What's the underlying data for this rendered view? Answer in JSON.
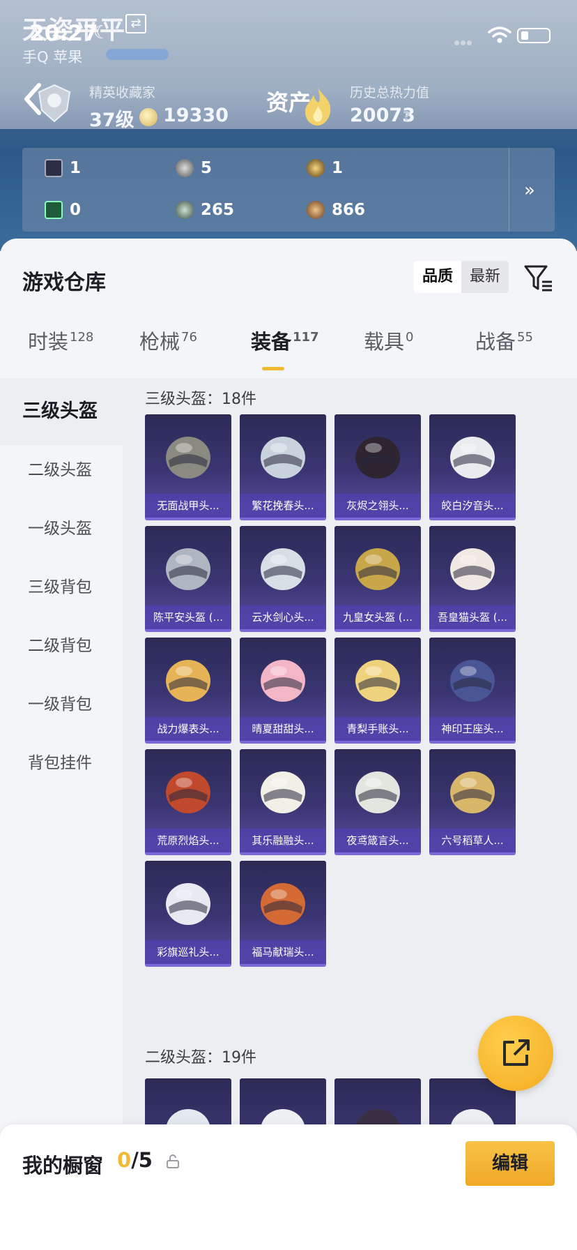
{
  "status": {
    "time": "20:27"
  },
  "profile": {
    "nickname": "天姿平平",
    "platform": "手Q 苹果",
    "rank_title": "精英收藏家",
    "level": "37级",
    "coins": "19330",
    "assets_label": "资产",
    "heat_title": "历史总热力值",
    "heat_value": "20073",
    "help": "?"
  },
  "stats": [
    {
      "icon": "card-icon",
      "value": "1"
    },
    {
      "icon": "silver-coin-icon",
      "value": "5"
    },
    {
      "icon": "gold-token-icon",
      "value": "1"
    },
    {
      "icon": "green-card-icon",
      "value": "0"
    },
    {
      "icon": "green-coin-icon",
      "value": "265"
    },
    {
      "icon": "bronze-coin-icon",
      "value": "866"
    }
  ],
  "warehouse": {
    "title": "游戏仓库",
    "sort_options": [
      "品质",
      "最新"
    ],
    "tabs": [
      {
        "label": "时装",
        "count": "128"
      },
      {
        "label": "枪械",
        "count": "76"
      },
      {
        "label": "装备",
        "count": "117"
      },
      {
        "label": "载具",
        "count": "0"
      },
      {
        "label": "战备",
        "count": "55"
      }
    ],
    "categories": [
      "三级头盔",
      "二级头盔",
      "一级头盔",
      "三级背包",
      "二级背包",
      "一级背包",
      "背包挂件"
    ],
    "group1_label": "三级头盔：18件",
    "group2_label": "二级头盔：19件",
    "items": [
      "无面战甲头...",
      "繁花挽春头...",
      "灰烬之翎头...",
      "皎白汐音头...",
      "陈平安头盔 (...",
      "云水剑心头...",
      "九皇女头盔 (...",
      "吾皇猫头盔 (...",
      "战力爆表头...",
      "晴夏甜甜头...",
      "青梨手账头...",
      "神印王座头...",
      "荒原烈焰头...",
      "其乐融融头...",
      "夜鸢箴言头...",
      "六号稻草人...",
      "彩旗巡礼头...",
      "福马献瑞头..."
    ],
    "item_colors": [
      "#8a8a80",
      "#c9d3de",
      "#2f2530",
      "#e9ecef",
      "#aeb6c2",
      "#d6dee6",
      "#c7a74a",
      "#f0e8e2",
      "#e6b457",
      "#f2b6c6",
      "#eed27e",
      "#4a5596",
      "#c14a2e",
      "#f1efe6",
      "#e2e6df",
      "#d9b76a",
      "#e8eaf2",
      "#d46a34"
    ]
  },
  "footer": {
    "title": "我的橱窗",
    "current": "0",
    "total": "/5",
    "edit_label": "编辑"
  }
}
